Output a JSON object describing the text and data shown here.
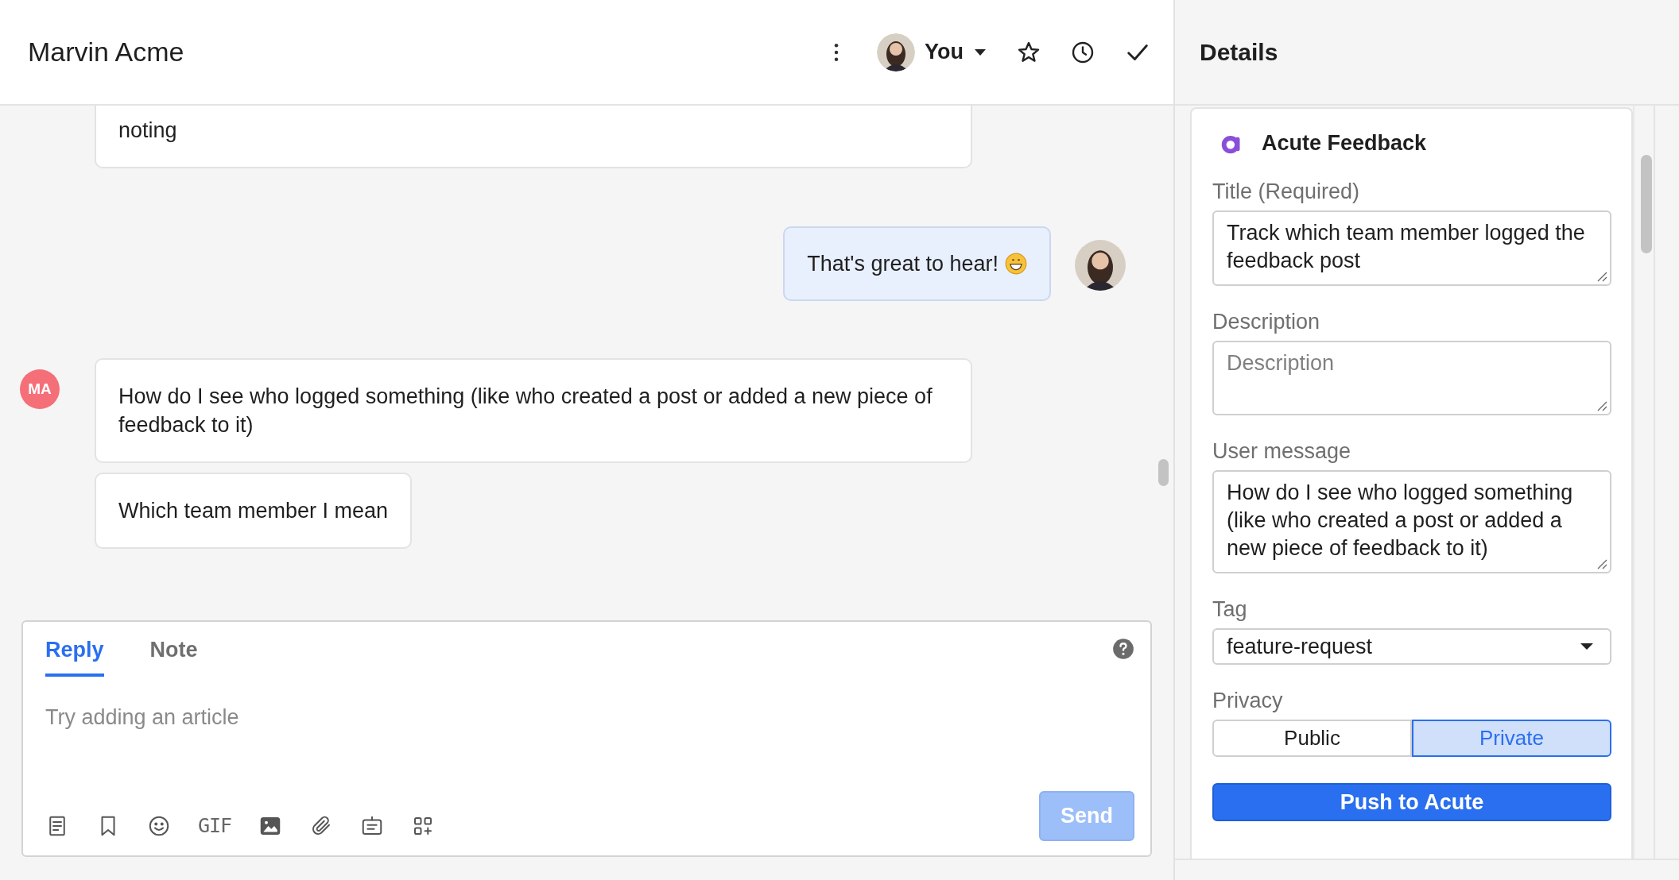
{
  "header": {
    "title": "Marvin Acme",
    "assignee": "You"
  },
  "messages": [
    {
      "kind": "customer",
      "continued": true,
      "text": "noting"
    },
    {
      "kind": "agent",
      "text": "That's great to hear!",
      "emoji": true
    },
    {
      "kind": "customer",
      "initials": "MA",
      "text": "How do I see who logged something (like who created a post or added a new piece of feedback to it)"
    },
    {
      "kind": "customer",
      "continued": true,
      "text": "Which team member I mean"
    }
  ],
  "composer": {
    "tabs": [
      {
        "label": "Reply",
        "selected": true
      },
      {
        "label": "Note",
        "selected": false
      }
    ],
    "placeholder": "Try adding an article",
    "gif_label": "GIF",
    "send": {
      "label": "Send",
      "disabled": true
    }
  },
  "details": {
    "title": "Details",
    "card": {
      "title": "Acute Feedback",
      "fields": [
        {
          "kind": "textarea",
          "label": "Title (Required)",
          "value": "Track which team member logged the feedback post"
        },
        {
          "kind": "textarea",
          "label": "Description",
          "placeholder": "Description"
        },
        {
          "kind": "textarea",
          "label": "User message",
          "value": "How do I see who logged something (like who created a post or added a new piece of feedback to it)"
        },
        {
          "kind": "select",
          "label": "Tag",
          "value": "feature-request"
        }
      ],
      "privacy": {
        "label": "Privacy",
        "options": [
          {
            "label": "Public",
            "selected": false
          },
          {
            "label": "Private",
            "selected": true
          }
        ]
      },
      "button": "Push to Acute"
    }
  }
}
